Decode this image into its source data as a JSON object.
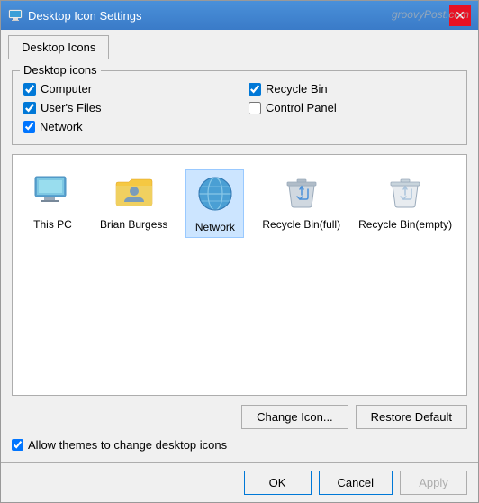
{
  "window": {
    "title": "Desktop Icon Settings",
    "close_label": "✕"
  },
  "tabs": [
    {
      "label": "Desktop Icons"
    }
  ],
  "desktop_icons_group": {
    "label": "Desktop icons",
    "checkboxes": [
      {
        "id": "cb-computer",
        "label": "Computer",
        "checked": true
      },
      {
        "id": "cb-recycle",
        "label": "Recycle Bin",
        "checked": true
      },
      {
        "id": "cb-users",
        "label": "User's Files",
        "checked": true
      },
      {
        "id": "cb-control",
        "label": "Control Panel",
        "checked": false
      }
    ],
    "network_checkbox": {
      "id": "cb-network",
      "label": "Network",
      "checked": true
    }
  },
  "icons": [
    {
      "name": "This PC",
      "type": "pc",
      "selected": false
    },
    {
      "name": "Brian Burgess",
      "type": "user",
      "selected": false
    },
    {
      "name": "Network",
      "type": "network",
      "selected": true
    },
    {
      "name": "Recycle Bin\n(full)",
      "type": "recycle-full",
      "selected": false
    },
    {
      "name": "Recycle Bin\n(empty)",
      "type": "recycle-empty",
      "selected": false
    }
  ],
  "buttons": {
    "change_icon": "Change Icon...",
    "restore_default": "Restore Default",
    "allow_themes": "Allow themes to change desktop icons",
    "ok": "OK",
    "cancel": "Cancel",
    "apply": "Apply"
  },
  "watermark": "groovyPost.com"
}
